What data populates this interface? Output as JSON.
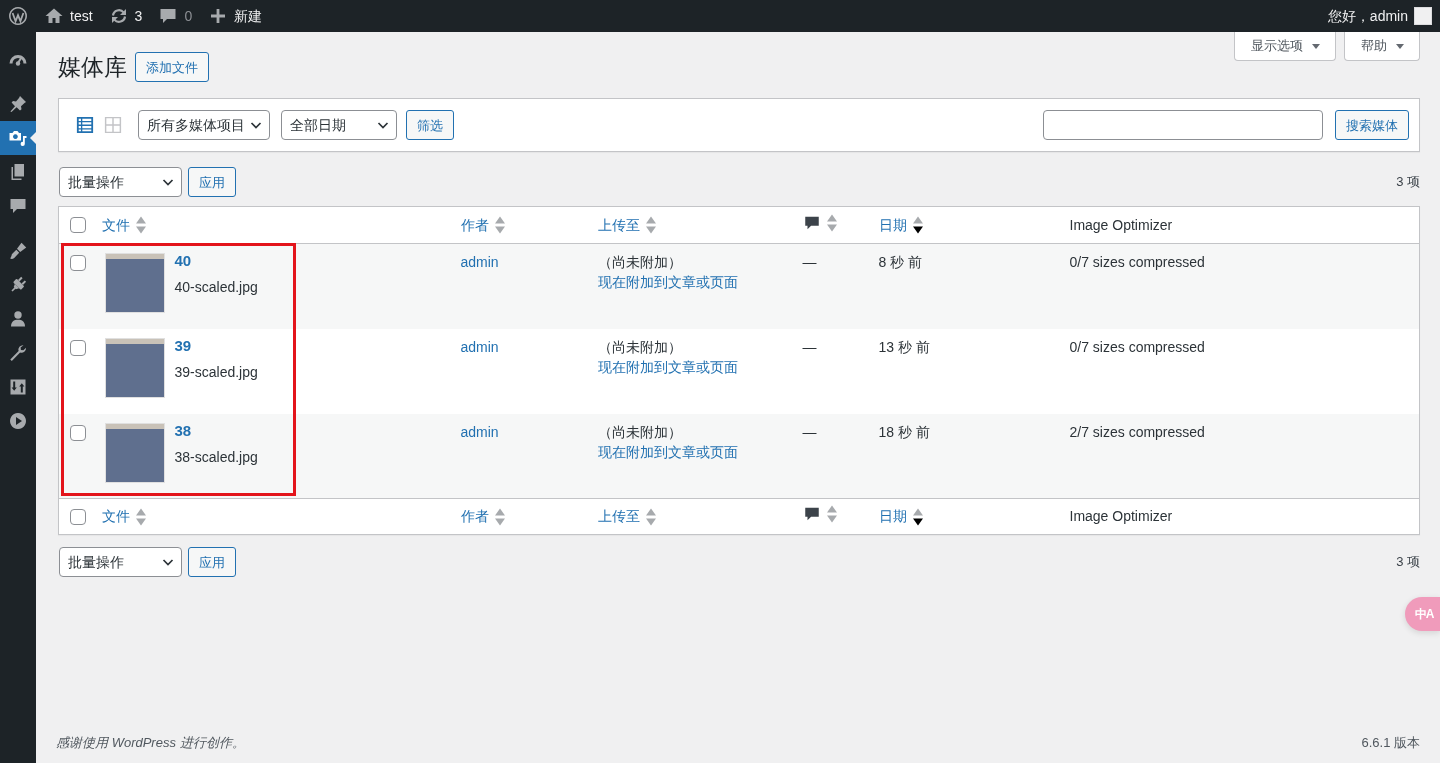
{
  "admin_bar": {
    "items": [
      {
        "kind": "logo"
      },
      {
        "kind": "site",
        "label": "test"
      },
      {
        "kind": "updates",
        "label": "3"
      },
      {
        "kind": "comments",
        "label": "0"
      },
      {
        "kind": "new",
        "label": "新建"
      }
    ],
    "greeting": "您好，admin"
  },
  "sidebar": {
    "groups": [
      {
        "items": [
          {
            "kind": "dashboard",
            "selected": false
          }
        ]
      },
      {
        "items": [
          {
            "kind": "posts",
            "selected": false
          },
          {
            "kind": "media",
            "selected": true
          },
          {
            "kind": "pages",
            "selected": false
          },
          {
            "kind": "comments",
            "selected": false
          }
        ]
      },
      {
        "items": [
          {
            "kind": "appearance",
            "selected": false
          },
          {
            "kind": "plugins",
            "selected": false
          },
          {
            "kind": "users",
            "selected": false
          },
          {
            "kind": "tools",
            "selected": false
          },
          {
            "kind": "settings",
            "selected": false
          },
          {
            "kind": "play",
            "selected": false
          }
        ]
      }
    ]
  },
  "screen_meta": [
    {
      "label": "显示选项",
      "expanded": false
    },
    {
      "label": "帮助",
      "expanded": false
    }
  ],
  "page": {
    "title": "媒体库",
    "add_button": "添加文件"
  },
  "filter_bar": {
    "view_modes": [
      {
        "kind": "list",
        "selected": true
      },
      {
        "kind": "grid",
        "selected": false
      }
    ],
    "type_select": "所有多媒体项目",
    "date_select": "全部日期",
    "filter_button": "筛选",
    "search_button": "搜索媒体"
  },
  "bulk_top": {
    "select": "批量操作",
    "apply": "应用",
    "count": "3 项"
  },
  "table": {
    "header": {
      "select_all": {
        "checked": false
      },
      "columns": [
        {
          "kind": "text",
          "label": "文件",
          "sortable": true,
          "sorted": false
        },
        {
          "kind": "text",
          "label": "作者",
          "sortable": true,
          "sorted": false
        },
        {
          "kind": "text",
          "label": "上传至",
          "sortable": true,
          "sorted": false
        },
        {
          "kind": "comments",
          "sortable": true,
          "sorted": false
        },
        {
          "kind": "text",
          "label": "日期",
          "sortable": true,
          "sorted": true
        },
        {
          "kind": "text",
          "label": "Image Optimizer",
          "sortable": false
        }
      ]
    },
    "rows": [
      {
        "checked": false,
        "title": "40",
        "filename": "40-scaled.jpg",
        "author": "admin",
        "parent": "（尚未附加）",
        "attach_link": "现在附加到文章或页面",
        "comments": "—",
        "date": "8 秒 前",
        "optimizer": "0/7 sizes compressed"
      },
      {
        "checked": false,
        "title": "39",
        "filename": "39-scaled.jpg",
        "author": "admin",
        "parent": "（尚未附加）",
        "attach_link": "现在附加到文章或页面",
        "comments": "—",
        "date": "13 秒 前",
        "optimizer": "0/7 sizes compressed"
      },
      {
        "checked": false,
        "title": "38",
        "filename": "38-scaled.jpg",
        "author": "admin",
        "parent": "（尚未附加）",
        "attach_link": "现在附加到文章或页面",
        "comments": "—",
        "date": "18 秒 前",
        "optimizer": "2/7 sizes compressed"
      }
    ],
    "footer": {
      "select_all": {
        "checked": false
      },
      "columns": [
        {
          "kind": "text",
          "label": "文件",
          "sortable": true,
          "sorted": false
        },
        {
          "kind": "text",
          "label": "作者",
          "sortable": true,
          "sorted": false
        },
        {
          "kind": "text",
          "label": "上传至",
          "sortable": true,
          "sorted": false
        },
        {
          "kind": "comments",
          "sortable": true,
          "sorted": false
        },
        {
          "kind": "text",
          "label": "日期",
          "sortable": true,
          "sorted": true
        },
        {
          "kind": "text",
          "label": "Image Optimizer",
          "sortable": false
        }
      ]
    }
  },
  "bulk_bottom": {
    "select": "批量操作",
    "apply": "应用",
    "count": "3 项"
  },
  "footer": {
    "thanks_before": "感谢使用 ",
    "thanks_link": "WordPress",
    "thanks_after": " 进行创作。",
    "version": "6.6.1 版本"
  },
  "translate_button": {
    "label": "中A"
  }
}
